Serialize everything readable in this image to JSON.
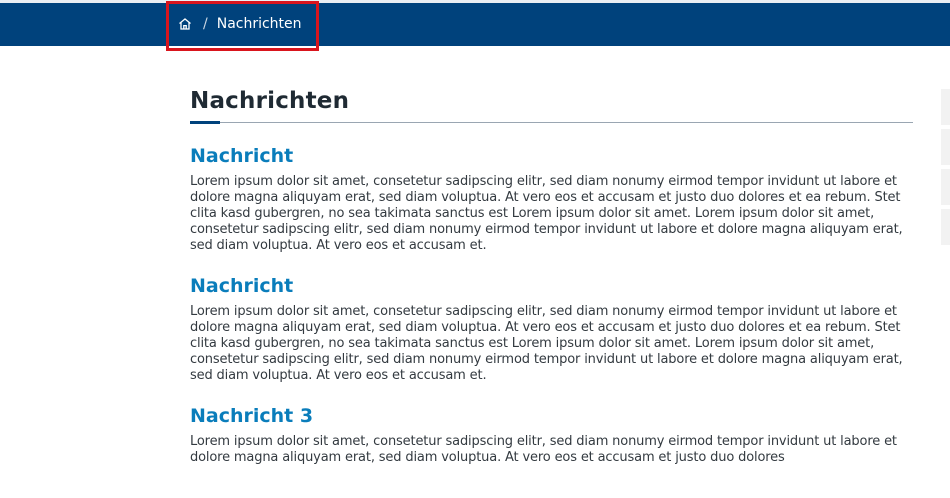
{
  "breadcrumb": {
    "home_icon": "home-icon",
    "separator": "/",
    "current": "Nachrichten"
  },
  "colors": {
    "header_bg": "#00427c",
    "heading": "#1f2a33",
    "article_title": "#0a7dbb",
    "highlight": "#d9151d"
  },
  "main": {
    "title": "Nachrichten",
    "articles": [
      {
        "title": "Nachricht",
        "body": "Lorem ipsum dolor sit amet, consetetur sadipscing elitr, sed diam nonumy eirmod tempor invidunt ut labore et dolore magna aliquyam erat, sed diam voluptua. At vero eos et accusam et justo duo dolores et ea rebum. Stet clita kasd gubergren, no sea takimata sanctus est Lorem ipsum dolor sit amet. Lorem ipsum dolor sit amet, consetetur sadipscing elitr, sed diam nonumy eirmod tempor invidunt ut labore et dolore magna aliquyam erat, sed diam voluptua. At vero eos et accusam et."
      },
      {
        "title": "Nachricht",
        "body": "Lorem ipsum dolor sit amet, consetetur sadipscing elitr, sed diam nonumy eirmod tempor invidunt ut labore et dolore magna aliquyam erat, sed diam voluptua. At vero eos et accusam et justo duo dolores et ea rebum. Stet clita kasd gubergren, no sea takimata sanctus est Lorem ipsum dolor sit amet. Lorem ipsum dolor sit amet, consetetur sadipscing elitr, sed diam nonumy eirmod tempor invidunt ut labore et dolore magna aliquyam erat, sed diam voluptua. At vero eos et accusam et."
      },
      {
        "title": "Nachricht 3",
        "body": "Lorem ipsum dolor sit amet, consetetur sadipscing elitr, sed diam nonumy eirmod tempor invidunt ut labore et dolore magna aliquyam erat, sed diam voluptua. At vero eos et accusam et justo duo dolores"
      }
    ]
  }
}
